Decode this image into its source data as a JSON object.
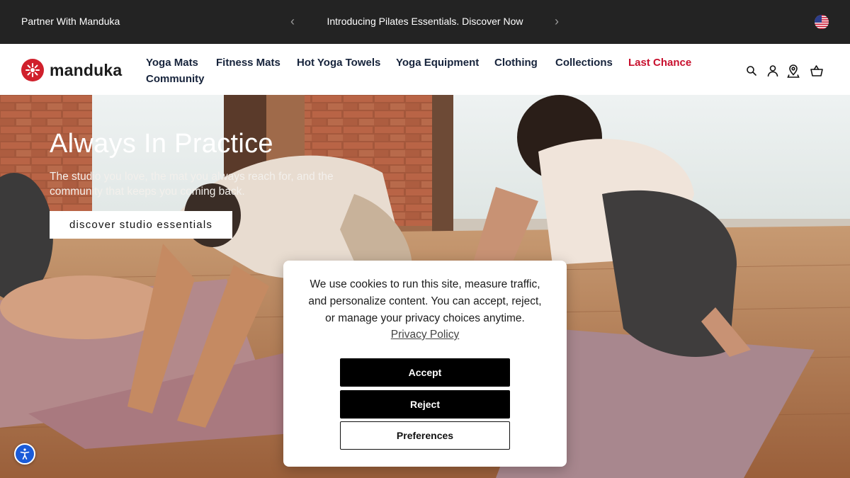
{
  "announcement": {
    "partner_label": "Partner With Manduka",
    "promo_text": "Introducing Pilates Essentials. Discover Now",
    "prev_symbol": "‹",
    "next_symbol": "›",
    "region_icon": "us-flag-icon"
  },
  "header": {
    "logo_text": "manduka",
    "nav": [
      {
        "label": "Yoga Mats"
      },
      {
        "label": "Fitness Mats"
      },
      {
        "label": "Hot Yoga Towels"
      },
      {
        "label": "Yoga Equipment"
      },
      {
        "label": "Clothing"
      },
      {
        "label": "Collections"
      },
      {
        "label": "Last Chance"
      },
      {
        "label": "Community"
      }
    ],
    "icons": [
      "search-icon",
      "account-icon",
      "store-locator-icon",
      "cart-icon"
    ]
  },
  "hero": {
    "title": "Always In Practice",
    "subtitle": "The studio you love, the mat you always reach for, and the community that keeps you coming back.",
    "cta_label": "discover studio essentials"
  },
  "cookie_banner": {
    "message": "We use cookies to run this site, measure traffic, and personalize content. You can accept, reject, or manage your privacy choices anytime.",
    "policy_link": "Privacy Policy",
    "accept_label": "Accept",
    "reject_label": "Reject",
    "preferences_label": "Preferences"
  },
  "colors": {
    "announcement_bg": "#232323",
    "brand_red": "#d0202c",
    "last_chance": "#c8102e",
    "nav_text": "#16233b",
    "accessibility_blue": "#1a5bd8"
  }
}
